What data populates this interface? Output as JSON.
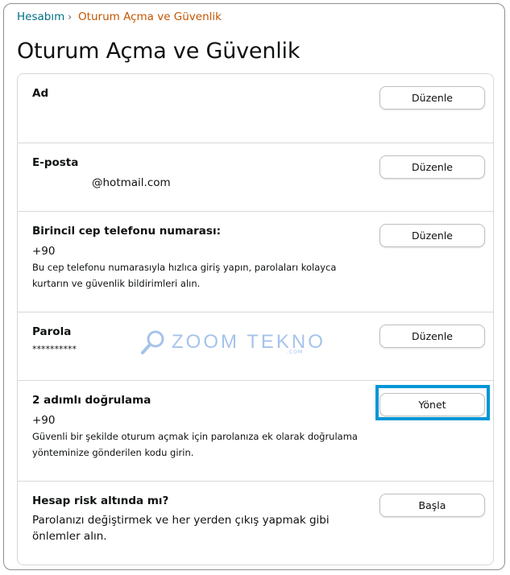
{
  "breadcrumb": {
    "root": "Hesabım",
    "separator": "›",
    "current": "Oturum Açma ve Güvenlik"
  },
  "page_title": "Oturum Açma ve Güvenlik",
  "rows": [
    {
      "label": "Ad",
      "button": "Düzenle"
    },
    {
      "label": "E-posta",
      "value": "@hotmail.com",
      "button": "Düzenle"
    },
    {
      "label": "Birincil cep telefonu numarası:",
      "value": "+90",
      "description": "Bu cep telefonu numarasıyla hızlıca giriş yapın, parolaları kolayca kurtarın ve güvenlik bildirimleri alın.",
      "button": "Düzenle"
    },
    {
      "label": "Parola",
      "value": "**********",
      "button": "Düzenle"
    },
    {
      "label": "2 adımlı doğrulama",
      "value": "+90",
      "description": "Güvenli bir şekilde oturum açmak için parolanıza ek olarak doğrulama yönteminize gönderilen kodu girin.",
      "button": "Yönet",
      "highlighted": true
    },
    {
      "label": "Hesap risk altında mı?",
      "description": "Parolanızı değiştirmek ve her yerden çıkış yapmak gibi önlemler alın.",
      "button": "Başla"
    }
  ],
  "watermark": {
    "text": "ZOOM TEKNO",
    "sub": ".COM"
  },
  "colors": {
    "link": "#007185",
    "current": "#c45500",
    "highlight": "#0096d6",
    "divider": "#d5d9d9"
  }
}
